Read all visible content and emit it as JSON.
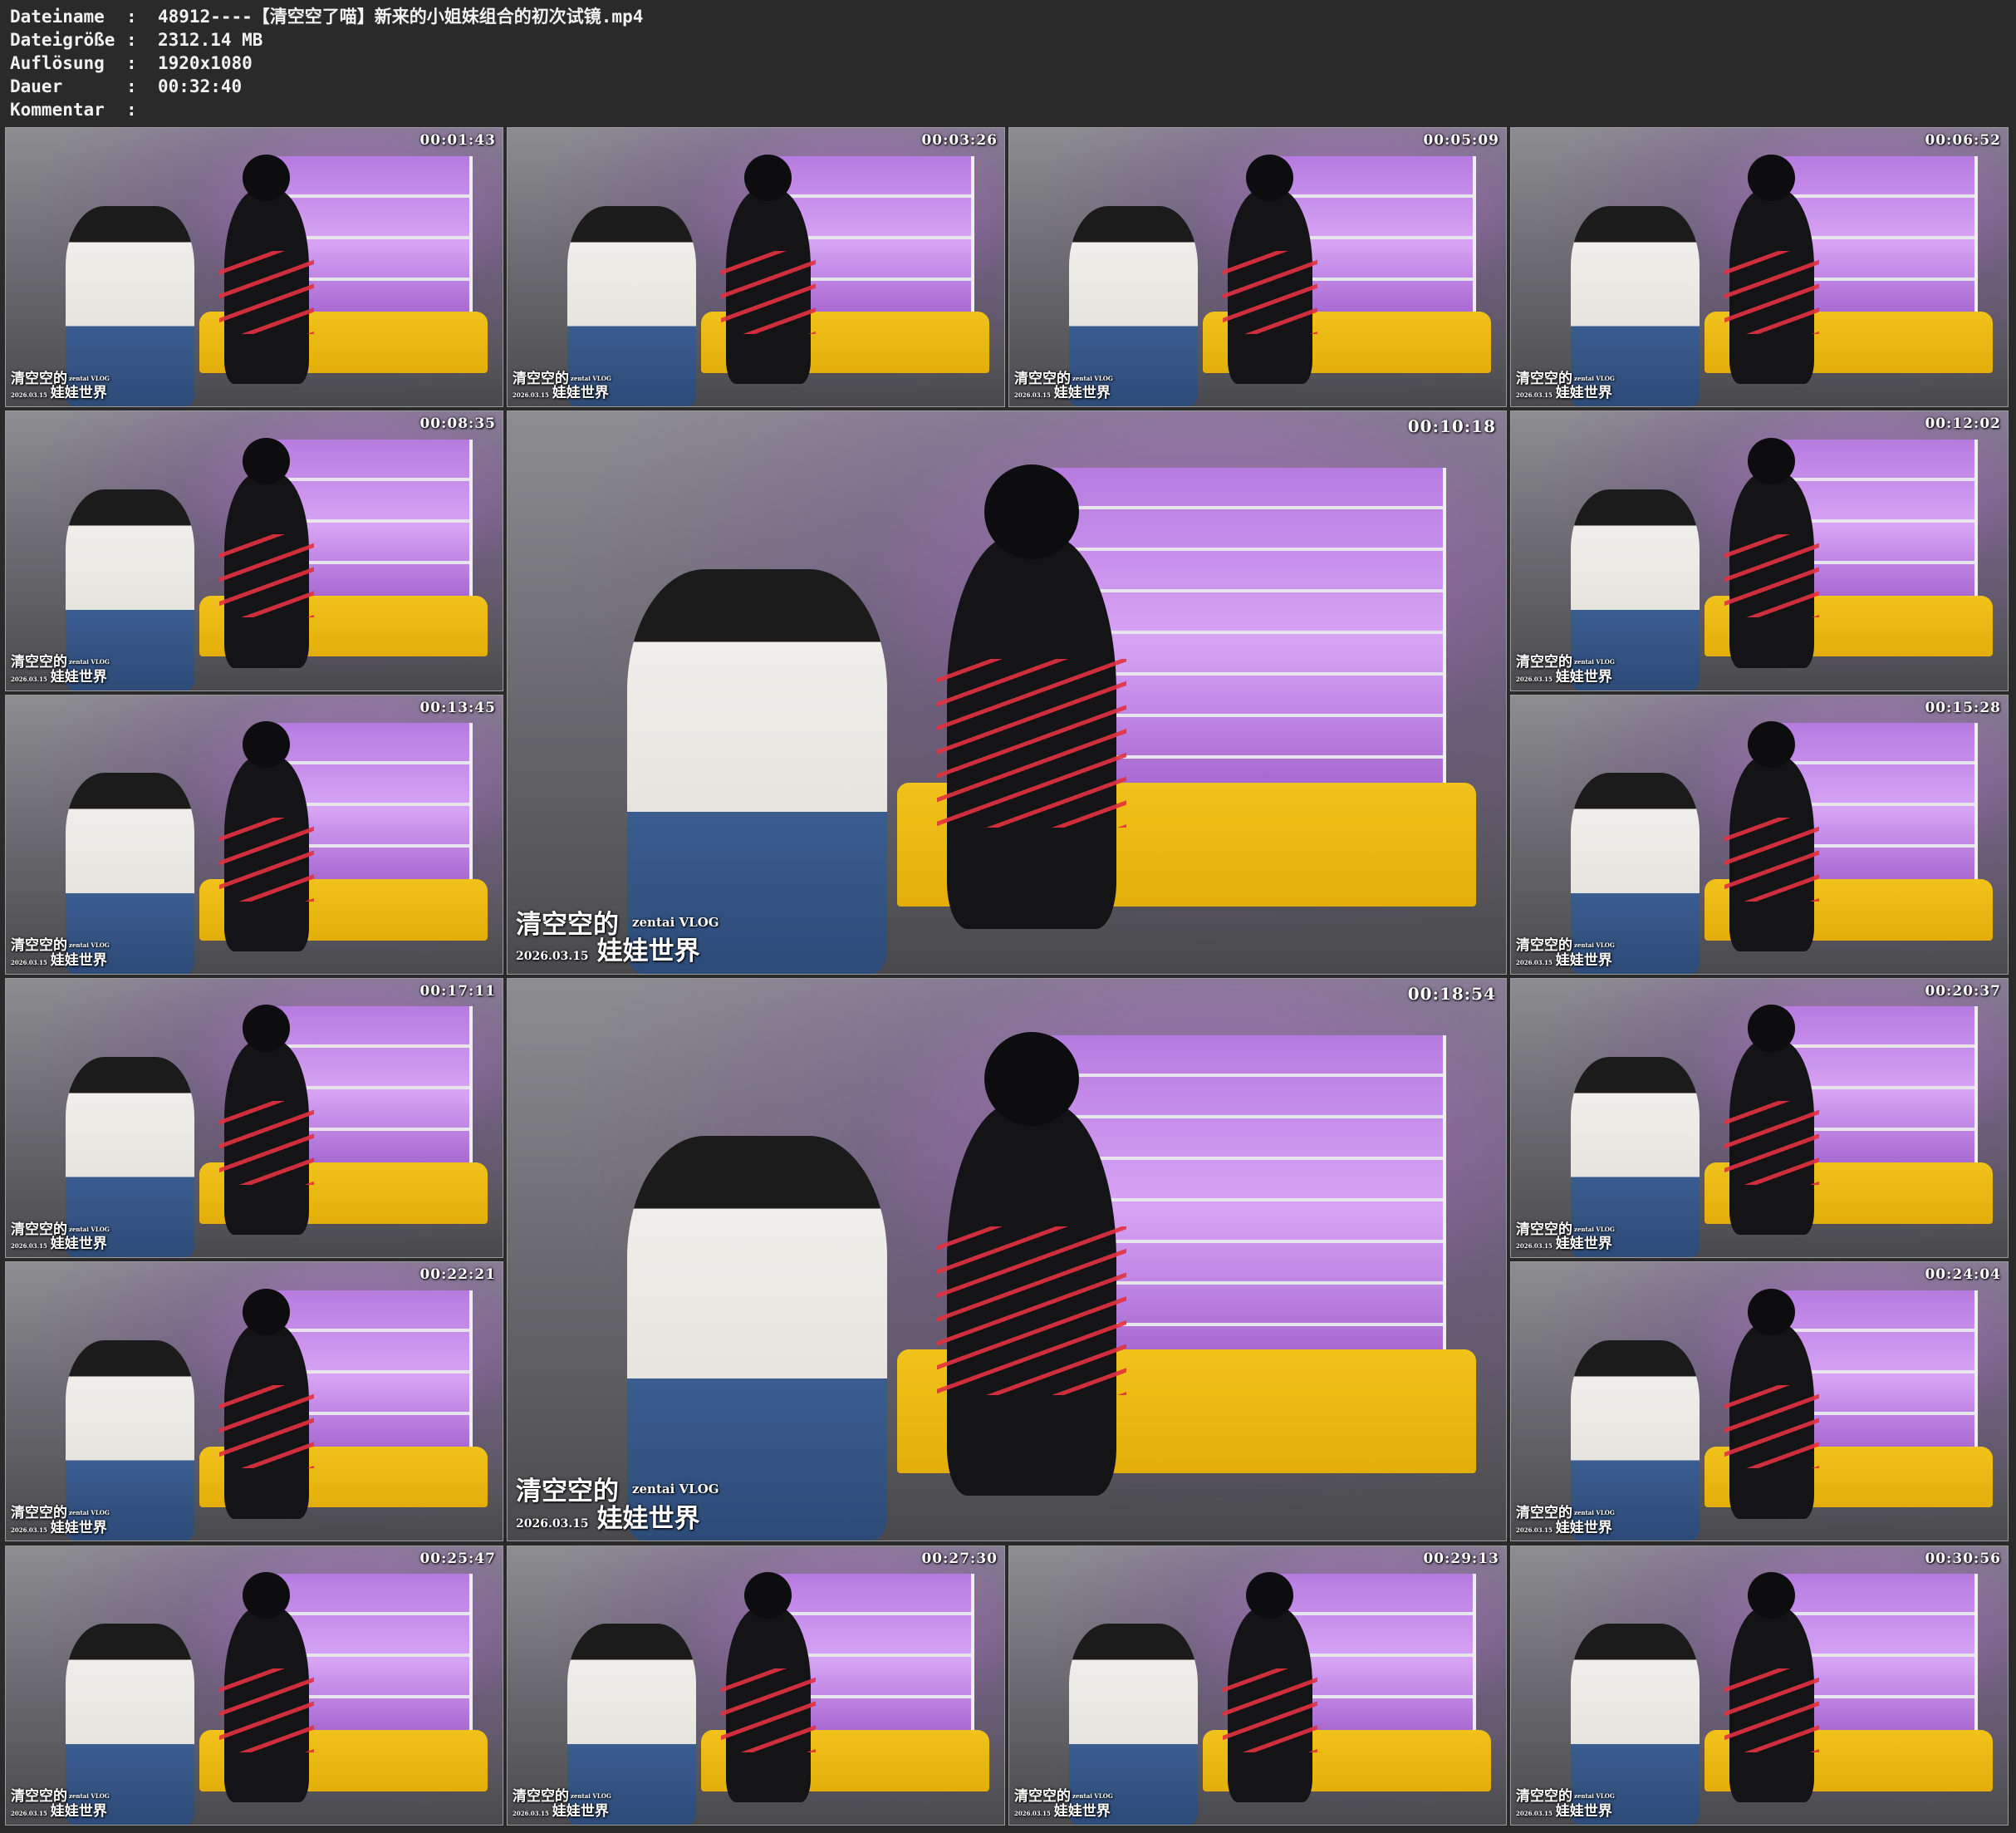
{
  "info": [
    {
      "key": "Dateiname",
      "sep": ":",
      "value": "48912----【清空空了喵】新来的小姐妹组合的初次试镜.mp4"
    },
    {
      "key": "Dateigröße",
      "sep": ":",
      "value": "2312.14 MB"
    },
    {
      "key": "Auflösung",
      "sep": ":",
      "value": "1920x1080"
    },
    {
      "key": "Dauer",
      "sep": ":",
      "value": "00:32:40"
    },
    {
      "key": "Kommentar",
      "sep": ":",
      "value": ""
    }
  ],
  "watermark": {
    "title": "清空空的",
    "subtitle": "zentai VLOG",
    "date": "2026.03.15",
    "title2": "娃娃世界"
  },
  "thumbnails": [
    {
      "time": "00:01:43",
      "size": "small"
    },
    {
      "time": "00:03:26",
      "size": "small"
    },
    {
      "time": "00:05:09",
      "size": "small"
    },
    {
      "time": "00:06:52",
      "size": "small"
    },
    {
      "time": "00:08:35",
      "size": "small"
    },
    {
      "time": "00:10:18",
      "size": "big"
    },
    {
      "time": "00:12:02",
      "size": "small"
    },
    {
      "time": "00:13:45",
      "size": "small"
    },
    {
      "time": "00:15:28",
      "size": "small"
    },
    {
      "time": "00:17:11",
      "size": "small"
    },
    {
      "time": "00:18:54",
      "size": "big"
    },
    {
      "time": "00:20:37",
      "size": "small"
    },
    {
      "time": "00:22:21",
      "size": "small"
    },
    {
      "time": "00:24:04",
      "size": "small"
    },
    {
      "time": "00:25:47",
      "size": "small"
    },
    {
      "time": "00:27:30",
      "size": "small"
    },
    {
      "time": "00:29:13",
      "size": "small"
    },
    {
      "time": "00:30:56",
      "size": "small"
    }
  ]
}
